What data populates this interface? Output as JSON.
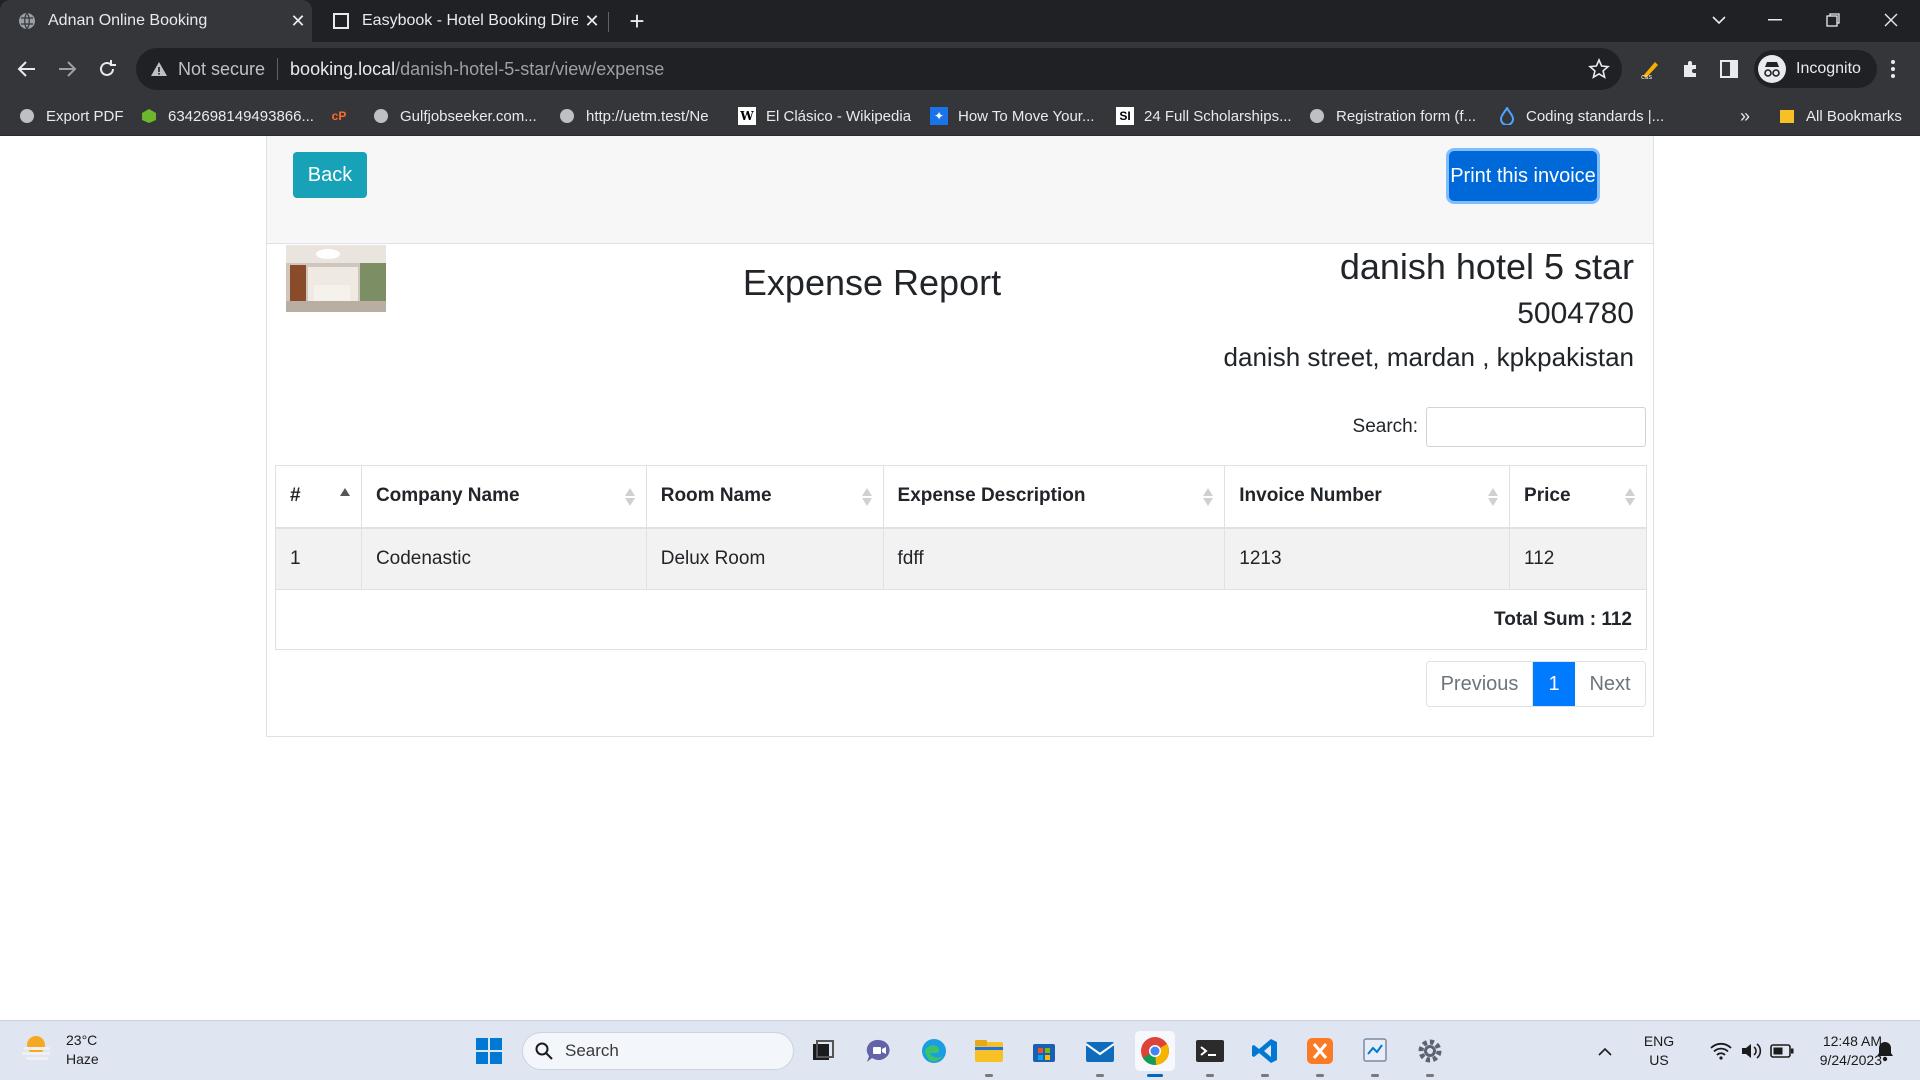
{
  "browser": {
    "tabs": [
      {
        "title": "Adnan Online Booking",
        "active": true
      },
      {
        "title": "Easybook - Hotel Booking Directo",
        "active": false
      }
    ],
    "omnibox": {
      "security_label": "Not secure",
      "url_host": "booking.local",
      "url_path": "/danish-hotel-5-star/view/expense"
    },
    "profile_label": "Incognito",
    "bookmarks": [
      "Export PDF",
      "6342698149493866...",
      "Gulfjobseeker.com...",
      "http://uetm.test/Ne",
      "El Clásico - Wikipedia",
      "How To Move Your...",
      "24 Full Scholarships...",
      "Registration form (f...",
      "Coding standards |..."
    ],
    "bookmarks_overflow": "»",
    "all_bookmarks_label": "All Bookmarks"
  },
  "page": {
    "back_label": "Back",
    "print_label": "Print this invoice",
    "report_title": "Expense Report",
    "hotel": {
      "name": "danish hotel 5 star",
      "phone": "5004780",
      "address": "danish street, mardan , kpkpakistan"
    },
    "search_label": "Search:",
    "search_value": "",
    "table": {
      "columns": [
        "#",
        "Company Name",
        "Room Name",
        "Expense Description",
        "Invoice Number",
        "Price"
      ],
      "rows": [
        [
          "1",
          "Codenastic",
          "Delux Room",
          "fdff",
          "1213",
          "112"
        ]
      ],
      "total_label": "Total Sum : 112"
    },
    "pagination": {
      "previous": "Previous",
      "current": "1",
      "next": "Next"
    }
  },
  "taskbar": {
    "weather_temp": "23°C",
    "weather_desc": "Haze",
    "search_placeholder": "Search",
    "lang_primary": "ENG",
    "lang_secondary": "US",
    "time": "12:48 AM",
    "date": "9/24/2023"
  },
  "colors": {
    "back_button": "#17a2b8",
    "print_button": "#0069d9",
    "pager_active": "#007bff",
    "chrome_dark": "#202124",
    "chrome_toolbar": "#35363a"
  }
}
